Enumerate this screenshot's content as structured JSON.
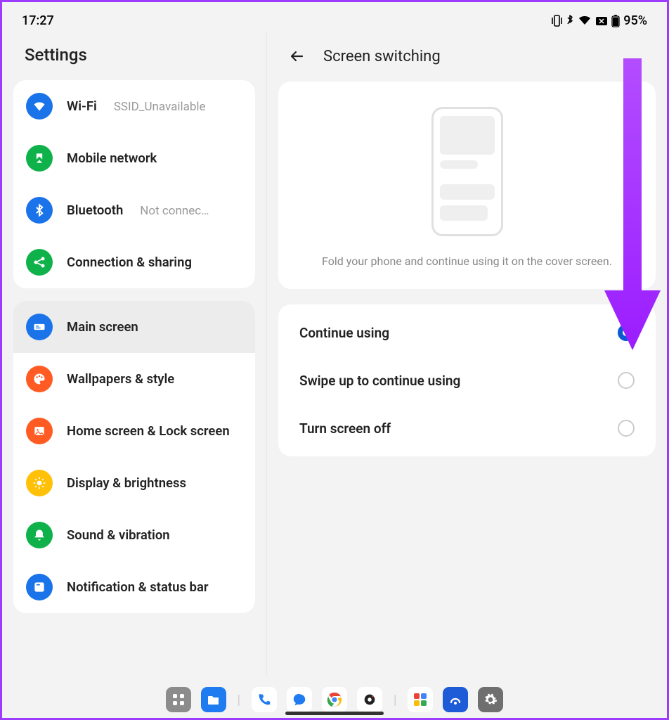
{
  "status": {
    "time": "17:27",
    "battery_percent": "95%"
  },
  "sidebar": {
    "title": "Settings",
    "group1": [
      {
        "label": "Wi-Fi",
        "value": "SSID_Unavailable",
        "color": "#1a73e8",
        "icon": "wifi"
      },
      {
        "label": "Mobile network",
        "value": "",
        "color": "#0fb24a",
        "icon": "mobile"
      },
      {
        "label": "Bluetooth",
        "value": "Not connec…",
        "color": "#1a73e8",
        "icon": "bluetooth"
      },
      {
        "label": "Connection & sharing",
        "value": "",
        "color": "#0fb24a",
        "icon": "share"
      }
    ],
    "group2": [
      {
        "label": "Main screen",
        "color": "#1a73e8",
        "icon": "mainscreen",
        "selected": true
      },
      {
        "label": "Wallpapers & style",
        "color": "#ff5b22",
        "icon": "palette"
      },
      {
        "label": "Home screen & Lock screen",
        "color": "#ff5b22",
        "icon": "image"
      },
      {
        "label": "Display & brightness",
        "color": "#ffc107",
        "icon": "brightness"
      },
      {
        "label": "Sound & vibration",
        "color": "#0fb24a",
        "icon": "sound"
      },
      {
        "label": "Notification & status bar",
        "color": "#1a73e8",
        "icon": "notification"
      }
    ]
  },
  "detail": {
    "title": "Screen switching",
    "preview_text": "Fold your phone and continue using it on the cover screen.",
    "options": [
      {
        "label": "Continue using",
        "checked": true
      },
      {
        "label": "Swipe up to continue using",
        "checked": false
      },
      {
        "label": "Turn screen off",
        "checked": false
      }
    ]
  }
}
